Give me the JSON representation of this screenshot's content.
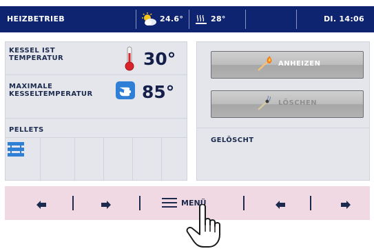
{
  "topbar": {
    "mode": "HEIZBETRIEB",
    "outdoor_temp": "24.6°",
    "water_temp": "28°",
    "datetime": "DI. 14:06"
  },
  "left": {
    "boiler_actual_label": "KESSEL IST TEMPERATUR",
    "boiler_actual_value": "30°",
    "boiler_max_label": "MAXIMALE KESSELTEMPERATUR",
    "boiler_max_value": "85°",
    "fuel_label": "PELLETS"
  },
  "right": {
    "ignite_label": "ANHEIZEN",
    "extinguish_label": "LÖSCHEN",
    "status": "GELÖSCHT"
  },
  "nav": {
    "menu_label": "MENÜ"
  },
  "colors": {
    "header_bg": "#0f2470",
    "panel_bg": "#e4e6ec",
    "nav_bg": "#f0d9e3",
    "accent_blue": "#2f7fd6",
    "thermometer_red": "#d8232a"
  }
}
